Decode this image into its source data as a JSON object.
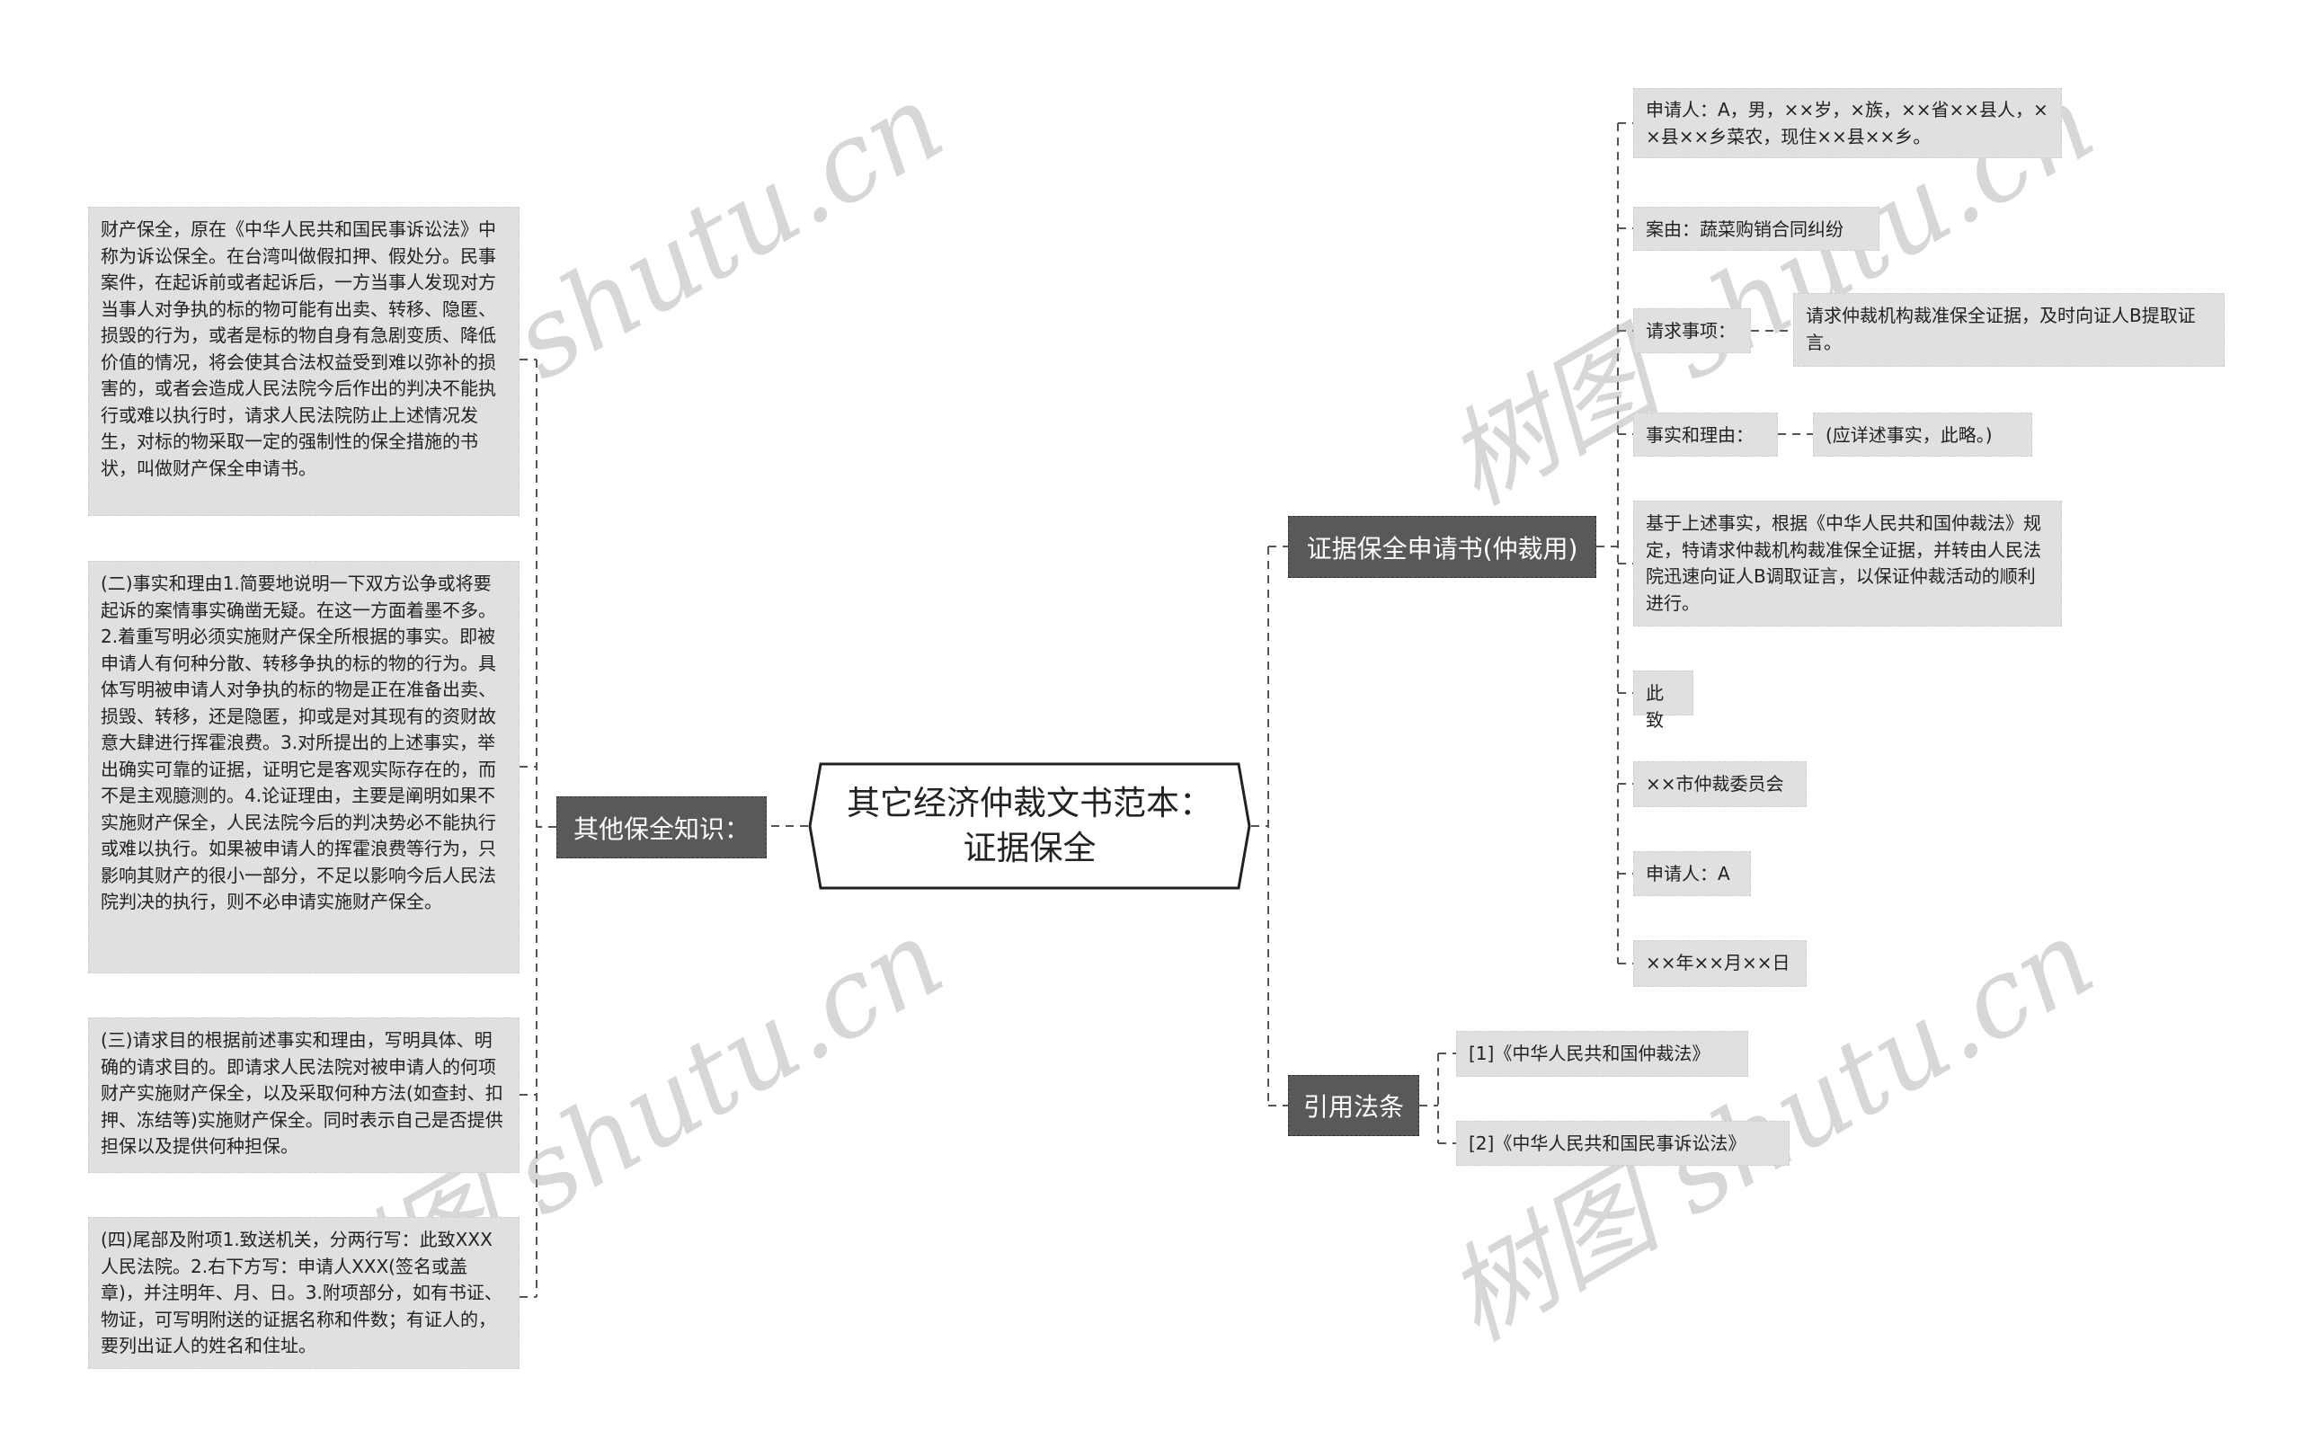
{
  "central_topic": {
    "line1": "其它经济仲裁文书范本：",
    "line2": "证据保全"
  },
  "left_branch": {
    "label": "其他保全知识：",
    "items": [
      "财产保全，原在《中华人民共和国民事诉讼法》中称为诉讼保全。在台湾叫做假扣押、假处分。民事案件，在起诉前或者起诉后，一方当事人发现对方当事人对争执的标的物可能有出卖、转移、隐匿、损毁的行为，或者是标的物自身有急剧变质、降低价值的情况，将会使其合法权益受到难以弥补的损害的，或者会造成人民法院今后作出的判决不能执行或难以执行时，请求人民法院防止上述情况发生，对标的物采取一定的强制性的保全措施的书状，叫做财产保全申请书。",
      "(二)事实和理由1.简要地说明一下双方讼争或将要起诉的案情事实确凿无疑。在这一方面着墨不多。2.着重写明必须实施财产保全所根据的事实。即被申请人有何种分散、转移争执的标的物的行为。具体写明被申请人对争执的标的物是正在准备出卖、损毁、转移，还是隐匿，抑或是对其现有的资财故意大肆进行挥霍浪费。3.对所提出的上述事实，举出确实可靠的证据，证明它是客观实际存在的，而不是主观臆测的。4.论证理由，主要是阐明如果不实施财产保全，人民法院今后的判决势必不能执行或难以执行。如果被申请人的挥霍浪费等行为，只影响其财产的很小一部分，不足以影响今后人民法院判决的执行，则不必申请实施财产保全。",
      "(三)请求目的根据前述事实和理由，写明具体、明确的请求目的。即请求人民法院对被申请人的何项财产实施财产保全，以及采取何种方法(如查封、扣押、冻结等)实施财产保全。同时表示自己是否提供担保以及提供何种担保。",
      "(四)尾部及附项1.致送机关，分两行写：此致XXX人民法院。2.右下方写：申请人XXX(签名或盖章)，并注明年、月、日。3.附项部分，如有书证、物证，可写明附送的证据名称和件数；有证人的，要列出证人的姓名和住址。"
    ]
  },
  "right_branch_application": {
    "label": "证据保全申请书(仲裁用)",
    "items": [
      {
        "text": "申请人：A，男，××岁，×族，××省××县人，××县××乡菜农，现住××县××乡。"
      },
      {
        "text": "案由：蔬菜购销合同纠纷"
      },
      {
        "text": "请求事项：",
        "child": "请求仲裁机构裁准保全证据，及时向证人B提取证言。"
      },
      {
        "text": "事实和理由：",
        "child": "(应详述事实，此略。)"
      },
      {
        "text": "基于上述事实，根据《中华人民共和国仲裁法》规定，特请求仲裁机构裁准保全证据，并转由人民法院迅速向证人B调取证言，以保证仲裁活动的顺利进行。"
      },
      {
        "text": "此致"
      },
      {
        "text": "××市仲裁委员会"
      },
      {
        "text": "申请人：A"
      },
      {
        "text": "××年××月××日"
      }
    ]
  },
  "right_branch_laws": {
    "label": "引用法条",
    "items": [
      "[1]《中华人民共和国仲裁法》",
      "[2]《中华人民共和国民事诉讼法》"
    ]
  },
  "watermark": "树图 shutu.cn"
}
